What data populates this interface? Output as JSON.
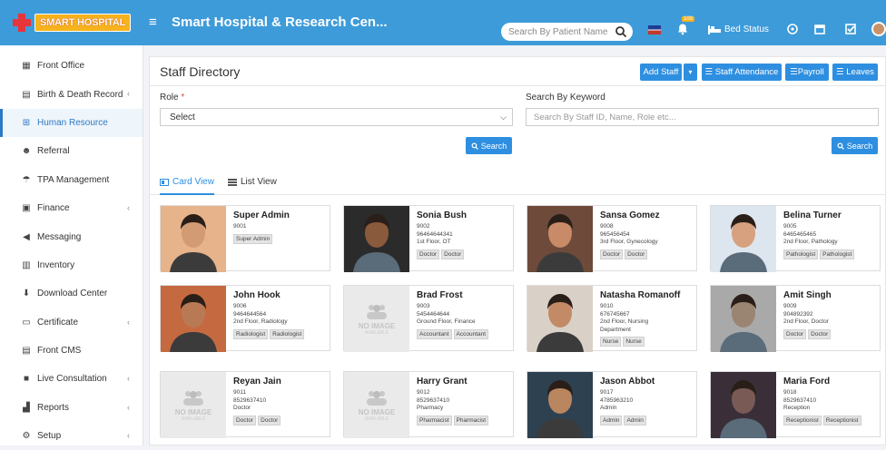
{
  "brand": {
    "logo_text": "SMART HOSPITAL"
  },
  "header": {
    "title": "Smart Hospital & Research Cen...",
    "search_placeholder": "Search By Patient Name",
    "bell_badge": "100",
    "bed_status": "Bed Status"
  },
  "sidebar": {
    "items": [
      {
        "label": "Front Office",
        "icon": "building-icon",
        "chevron": false
      },
      {
        "label": "Birth & Death Record",
        "icon": "calendar-icon",
        "chevron": true
      },
      {
        "label": "Human Resource",
        "icon": "sitemap-icon",
        "chevron": false,
        "active": true
      },
      {
        "label": "Referral",
        "icon": "users-icon",
        "chevron": false
      },
      {
        "label": "TPA Management",
        "icon": "umbrella-icon",
        "chevron": false
      },
      {
        "label": "Finance",
        "icon": "money-icon",
        "chevron": true
      },
      {
        "label": "Messaging",
        "icon": "bullhorn-icon",
        "chevron": false
      },
      {
        "label": "Inventory",
        "icon": "inventory-icon",
        "chevron": false
      },
      {
        "label": "Download Center",
        "icon": "download-icon",
        "chevron": false
      },
      {
        "label": "Certificate",
        "icon": "certificate-icon",
        "chevron": true
      },
      {
        "label": "Front CMS",
        "icon": "cms-icon",
        "chevron": false
      },
      {
        "label": "Live Consultation",
        "icon": "video-icon",
        "chevron": true
      },
      {
        "label": "Reports",
        "icon": "chart-icon",
        "chevron": true
      },
      {
        "label": "Setup",
        "icon": "gears-icon",
        "chevron": true
      }
    ]
  },
  "page": {
    "title": "Staff Directory",
    "buttons": {
      "add_staff": "Add Staff",
      "attendance": "Staff Attendance",
      "payroll": "Payroll",
      "leaves": "Leaves"
    },
    "filters": {
      "role_label": "Role",
      "role_required": "*",
      "role_value": "Select",
      "keyword_label": "Search By Keyword",
      "keyword_placeholder": "Search By Staff ID, Name, Role etc...",
      "search_label": "Search"
    },
    "tabs": {
      "card_view": "Card View",
      "list_view": "List View"
    },
    "no_image": {
      "title": "NO IMAGE",
      "sub": "AVAILABLE"
    }
  },
  "staff": [
    {
      "name": "Super Admin",
      "lines": [
        "9001"
      ],
      "badges": [
        "Super Admin"
      ],
      "photo": "photo"
    },
    {
      "name": "Sonia Bush",
      "lines": [
        "9002",
        "96464644341",
        "1st Floor, OT"
      ],
      "badges": [
        "Doctor",
        "Doctor"
      ],
      "photo": "photo"
    },
    {
      "name": "Sansa Gomez",
      "lines": [
        "9008",
        "965456454",
        "3rd Floor, Gynecology"
      ],
      "badges": [
        "Doctor",
        "Doctor"
      ],
      "photo": "photo"
    },
    {
      "name": "Belina Turner",
      "lines": [
        "9005",
        "6465465465",
        "2nd Floor, Pathology"
      ],
      "badges": [
        "Pathologist",
        "Pathologist"
      ],
      "photo": "photo"
    },
    {
      "name": "John Hook",
      "lines": [
        "9006",
        "9464644564",
        "2nd Floor, Radiology"
      ],
      "badges": [
        "Radiologist",
        "Radiologist"
      ],
      "photo": "photo"
    },
    {
      "name": "Brad Frost",
      "lines": [
        "9003",
        "5454464644",
        "Ground Floor, Finance"
      ],
      "badges": [
        "Accountant",
        "Accountant"
      ],
      "photo": "none"
    },
    {
      "name": "Natasha Romanoff",
      "lines": [
        "9010",
        "676745667",
        "2nd Floor, Nursing",
        "Department"
      ],
      "badges": [
        "Nurse",
        "Nurse"
      ],
      "photo": "photo"
    },
    {
      "name": "Amit Singh",
      "lines": [
        "9009",
        "904892392",
        "2nd Floor, Doctor"
      ],
      "badges": [
        "Doctor",
        "Doctor"
      ],
      "photo": "photo"
    },
    {
      "name": "Reyan Jain",
      "lines": [
        "9011",
        "8529637410",
        "Doctor"
      ],
      "badges": [
        "Doctor",
        "Doctor"
      ],
      "photo": "none"
    },
    {
      "name": "Harry Grant",
      "lines": [
        "9012",
        "8529637410",
        "Pharmacy"
      ],
      "badges": [
        "Pharmacist",
        "Pharmacist"
      ],
      "photo": "none"
    },
    {
      "name": "Jason Abbot",
      "lines": [
        "9017",
        "4785963210",
        "Admin"
      ],
      "badges": [
        "Admin",
        "Admin"
      ],
      "photo": "photo"
    },
    {
      "name": "Maria Ford",
      "lines": [
        "9018",
        "8529637410",
        "Reception"
      ],
      "badges": [
        "Receptionist",
        "Receptionist"
      ],
      "photo": "photo"
    }
  ]
}
